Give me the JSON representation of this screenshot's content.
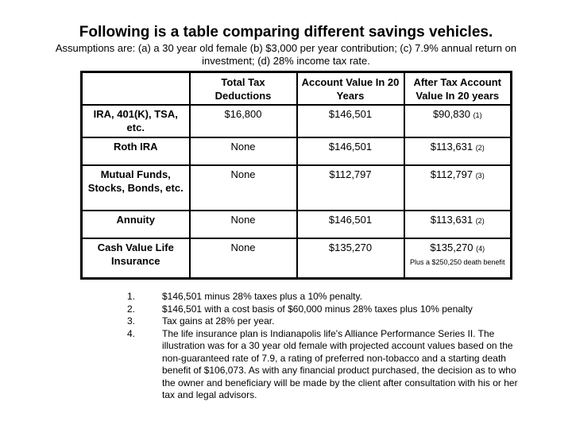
{
  "title": "Following is a table comparing different savings vehicles.",
  "assumptions": "Assumptions are: (a) a 30 year old female (b) $3,000 per year contribution; (c) 7.9% annual return on investment; (d) 28% income tax rate.",
  "table": {
    "headers": [
      "",
      "Total Tax Deductions",
      "Account Value In 20 Years",
      "After Tax Account Value In 20 years"
    ],
    "rows": [
      {
        "label": "IRA, 401(K), TSA, etc.",
        "tax_deductions": "$16,800",
        "account_value": "$146,501",
        "after_tax": "$90,830",
        "ref": "(1)",
        "note": ""
      },
      {
        "label": "Roth IRA",
        "tax_deductions": "None",
        "account_value": "$146,501",
        "after_tax": "$113,631",
        "ref": "(2)",
        "note": ""
      },
      {
        "label": "Mutual Funds, Stocks, Bonds, etc.",
        "tax_deductions": "None",
        "account_value": "$112,797",
        "after_tax": "$112,797",
        "ref": "(3)",
        "note": ""
      },
      {
        "label": "Annuity",
        "tax_deductions": "None",
        "account_value": "$146,501",
        "after_tax": "$113,631",
        "ref": "(2)",
        "note": ""
      },
      {
        "label": "Cash Value Life Insurance",
        "tax_deductions": "None",
        "account_value": "$135,270",
        "after_tax": "$135,270",
        "ref": "(4)",
        "note": "Plus a $250,250 death benefit"
      }
    ]
  },
  "footnotes": [
    {
      "num": "1.",
      "text": "$146,501 minus 28% taxes plus a 10% penalty."
    },
    {
      "num": "2.",
      "text": "$146,501 with a cost basis of $60,000 minus 28% taxes plus 10% penalty"
    },
    {
      "num": "3.",
      "text": "Tax gains at 28% per year."
    },
    {
      "num": "4.",
      "text": "The life insurance plan is Indianapolis life's Alliance Performance Series II.  The illustration was for a 30 year old female with projected account values based on the non-guaranteed rate of 7.9, a rating of preferred non-tobacco and a starting death benefit of $106,073.  As with any financial product purchased, the decision as to who the owner and beneficiary will be made by the client after consultation with his or her tax and legal advisors."
    }
  ]
}
